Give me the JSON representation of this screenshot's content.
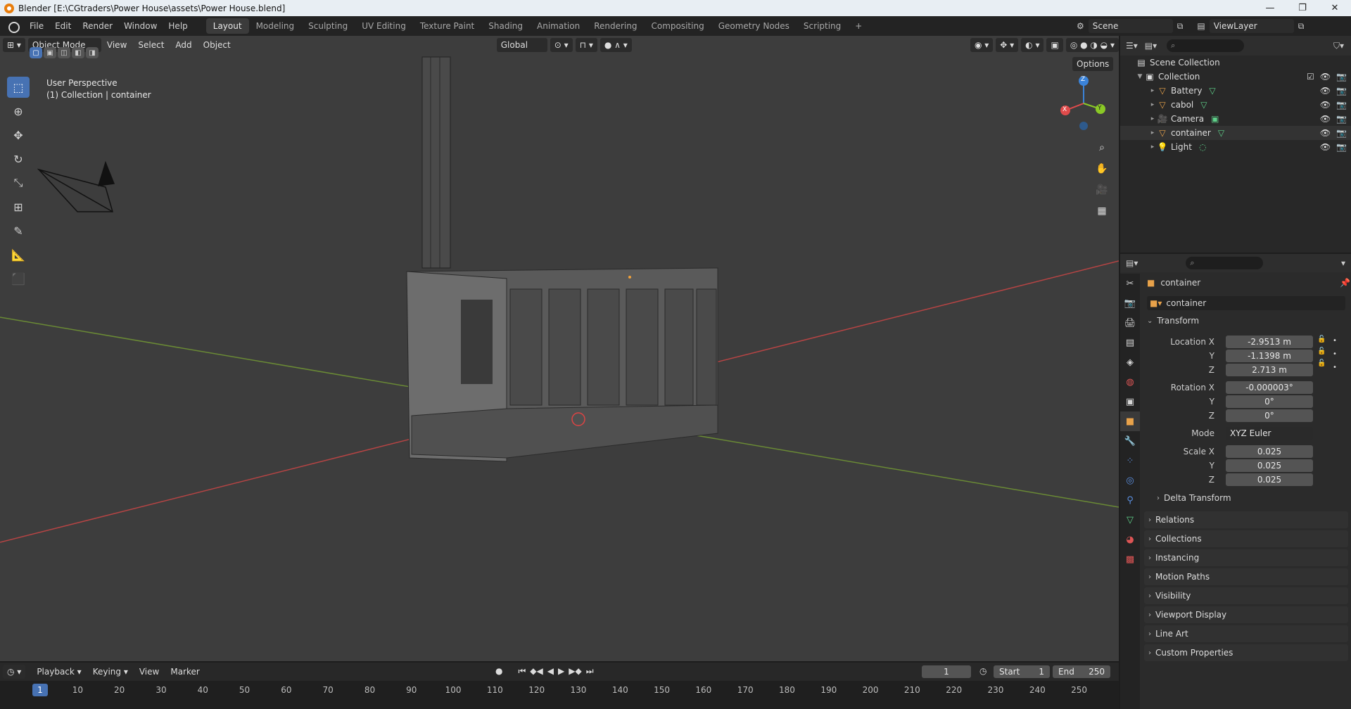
{
  "window": {
    "title": "Blender [E:\\CGtraders\\Power House\\assets\\Power House.blend]",
    "controls": [
      "—",
      "❐",
      "✕"
    ]
  },
  "menu": {
    "items": [
      "File",
      "Edit",
      "Render",
      "Window",
      "Help"
    ],
    "workspaces": [
      "Layout",
      "Modeling",
      "Sculpting",
      "UV Editing",
      "Texture Paint",
      "Shading",
      "Animation",
      "Rendering",
      "Compositing",
      "Geometry Nodes",
      "Scripting",
      "+"
    ],
    "active_workspace": "Layout",
    "scene": "Scene",
    "view_layer": "ViewLayer"
  },
  "viewport": {
    "mode": "Object Mode",
    "menus": [
      "View",
      "Select",
      "Add",
      "Object"
    ],
    "orientation": "Global",
    "options": "Options",
    "overlay_title": "User Perspective",
    "overlay_sub": "(1) Collection | container",
    "gizmo": {
      "x": "X",
      "y": "Y",
      "z": "Z"
    }
  },
  "outliner": {
    "scene_collection": "Scene Collection",
    "collection": "Collection",
    "objects": [
      {
        "name": "Battery",
        "icon": "mesh-icon"
      },
      {
        "name": "cabol",
        "icon": "mesh-icon"
      },
      {
        "name": "Camera",
        "icon": "camera-icon"
      },
      {
        "name": "container",
        "icon": "mesh-icon"
      },
      {
        "name": "Light",
        "icon": "light-icon"
      }
    ]
  },
  "properties": {
    "object_name": "container",
    "data_name": "container",
    "transform_title": "Transform",
    "location_label": "Location X",
    "location": [
      "-2.9513 m",
      "-1.1398 m",
      "2.713 m"
    ],
    "rotation_label": "Rotation X",
    "rotation": [
      "-0.000003°",
      "0°",
      "0°"
    ],
    "mode_label": "Mode",
    "mode_value": "XYZ Euler",
    "scale_label": "Scale X",
    "scale": [
      "0.025",
      "0.025",
      "0.025"
    ],
    "axis_y": "Y",
    "axis_z": "Z",
    "delta": "Delta Transform",
    "panels": [
      "Relations",
      "Collections",
      "Instancing",
      "Motion Paths",
      "Visibility",
      "Viewport Display",
      "Line Art",
      "Custom Properties"
    ]
  },
  "timeline": {
    "menus": [
      "Playback",
      "Keying",
      "View",
      "Marker"
    ],
    "current_frame": "1",
    "start_label": "Start",
    "start": "1",
    "end_label": "End",
    "end": "250",
    "ruler": [
      "1",
      "10",
      "20",
      "30",
      "40",
      "50",
      "60",
      "70",
      "80",
      "90",
      "100",
      "110",
      "120",
      "130",
      "140",
      "150",
      "160",
      "170",
      "180",
      "190",
      "200",
      "210",
      "220",
      "230",
      "240",
      "250"
    ]
  },
  "colors": {
    "accent": "#4772b3",
    "x_axis": "#e04b4b",
    "y_axis": "#8ac926",
    "z_axis": "#3b83d9",
    "mesh_icon": "#e8a24a",
    "vertex_icon": "#5fd18a"
  }
}
